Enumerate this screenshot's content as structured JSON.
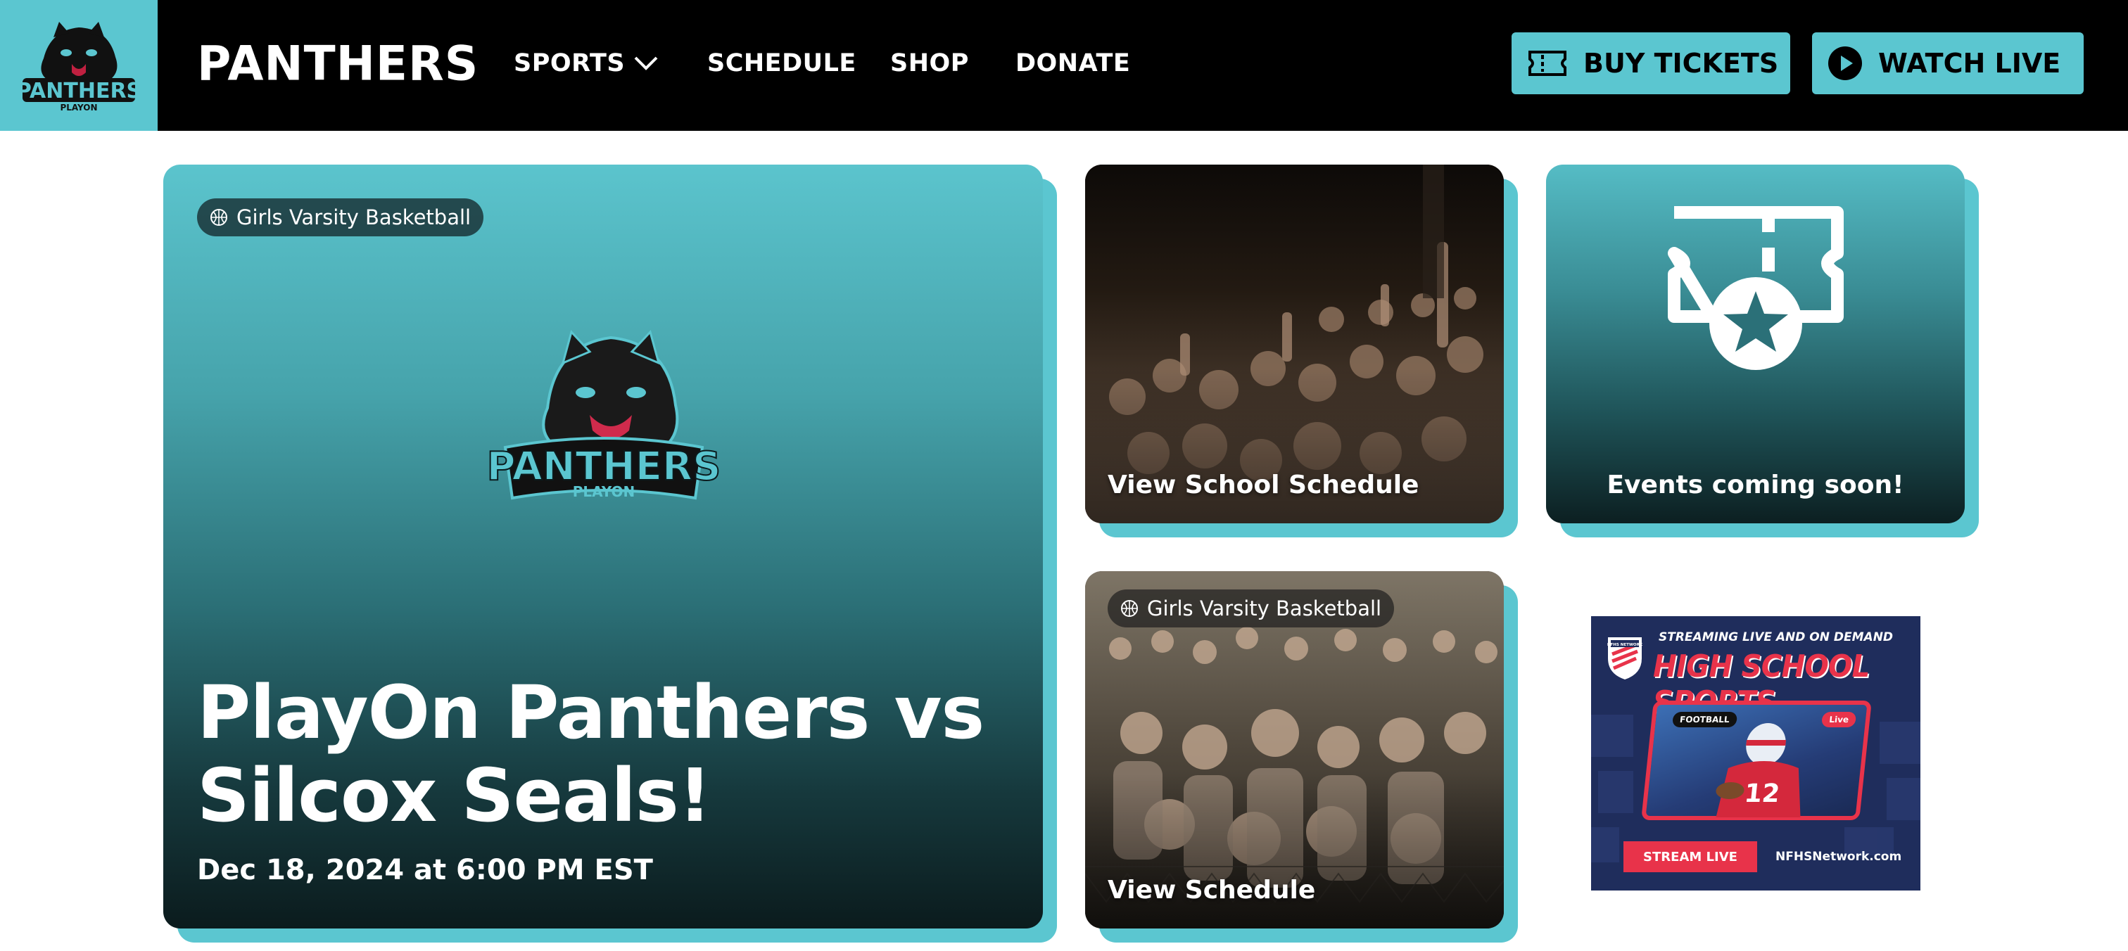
{
  "header": {
    "brand": "PANTHERS",
    "logo": {
      "word": "PANTHERS",
      "sub": "PLAYON"
    },
    "nav": [
      {
        "label": "SPORTS"
      },
      {
        "label": "SCHEDULE"
      },
      {
        "label": "SHOP"
      },
      {
        "label": "DONATE"
      }
    ],
    "buttons": {
      "tickets": "BUY TICKETS",
      "watch": "WATCH LIVE"
    }
  },
  "hero": {
    "sport": "Girls Varsity Basketball",
    "title": "PlayOn Panthers vs Silcox Seals!",
    "date": "Dec 18, 2024 at 6:00 PM EST"
  },
  "cards": {
    "school_schedule": "View School Schedule",
    "events": "Events coming soon!",
    "schedule": {
      "sport": "Girls Varsity Basketball",
      "label": "View Schedule"
    }
  },
  "ad": {
    "subtitle": "STREAMING LIVE AND ON DEMAND",
    "title": "HIGH SCHOOL SPORTS",
    "tag_sport": "FOOTBALL",
    "tag_live": "Live",
    "jersey": "12",
    "logo_text": "NFHS NETWORK",
    "button": "STREAM LIVE",
    "url": "NFHSNetwork.com"
  },
  "colors": {
    "accent": "#5bc6d0",
    "header_bg": "#000000",
    "ad_red": "#e8334a",
    "ad_navy": "#1f2d5c"
  },
  "icons": [
    "panther-logo",
    "chevron-down-icon",
    "ticket-icon",
    "play-icon",
    "basketball-icon",
    "ticket-star-icon"
  ]
}
